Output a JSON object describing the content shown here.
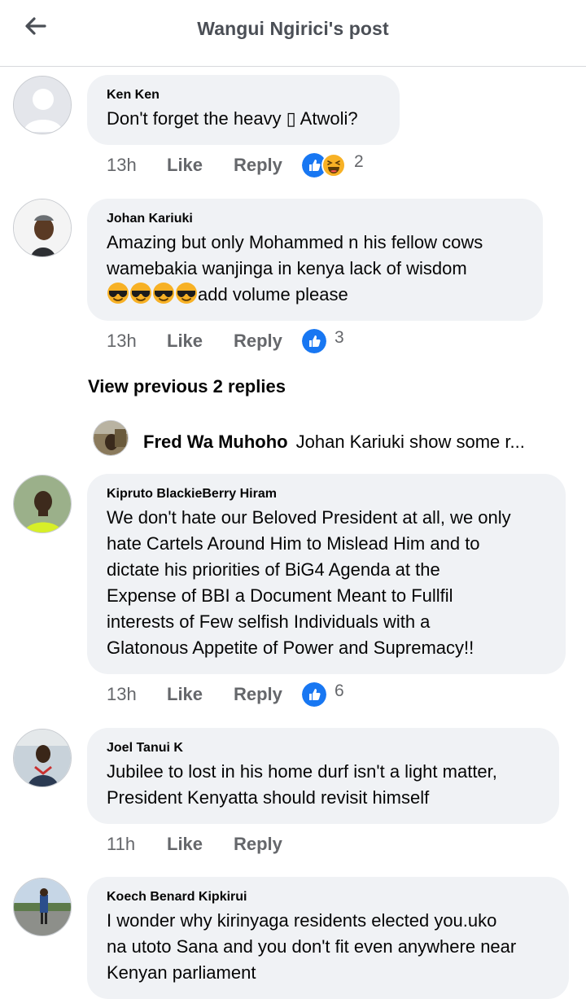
{
  "header": {
    "title": "Wangui Ngirici's post"
  },
  "comments": [
    {
      "author": "Ken Ken",
      "text": "Don't forget the heavy ▯ Atwoli?",
      "time": "13h",
      "like": "Like",
      "reply": "Reply",
      "reaction_icons": [
        "like-reaction-icon",
        "haha-reaction-icon"
      ],
      "reaction_count": "2"
    },
    {
      "author": "Johan Kariuki",
      "text_lines": [
        "Amazing but only Mohammed n his fellow cows",
        "wamebakia wanjinga in kenya lack of wisdom"
      ],
      "text_tail": "add volume please",
      "emojis": [
        "sunglasses-emoji",
        "sunglasses-emoji",
        "sunglasses-emoji",
        "sunglasses-emoji"
      ],
      "time": "13h",
      "like": "Like",
      "reply": "Reply",
      "reaction_icons": [
        "like-reaction-icon"
      ],
      "reaction_count": "3"
    },
    {
      "author": "Kipruto BlackieBerry Hiram",
      "text_lines": [
        "We don't hate our Beloved President at all, we only",
        "hate Cartels Around Him to Mislead Him and to",
        "dictate his priorities of BiG4 Agenda  at the",
        "Expense of BBI a Document Meant to Fullfil",
        "interests of Few selfish  Individuals with a",
        "Glatonous Appetite of Power and Supremacy!!"
      ],
      "time": "13h",
      "like": "Like",
      "reply": "Reply",
      "reaction_icons": [
        "like-reaction-icon"
      ],
      "reaction_count": "6"
    },
    {
      "author": "Joel Tanui K",
      "text_lines": [
        "Jubilee to lost in his home durf isn't a light matter,",
        "President Kenyatta should revisit himself"
      ],
      "time": "11h",
      "like": "Like",
      "reply": "Reply"
    },
    {
      "author": "Koech Benard Kipkirui",
      "text_lines": [
        "I wonder why kirinyaga residents elected you.uko",
        "na utoto Sana and you don't fit even anywhere near",
        "Kenyan parliament"
      ]
    }
  ],
  "view_previous": "View previous 2 replies",
  "reply_preview": {
    "author": "Fred Wa Muhoho",
    "text": "Johan Kariuki show some r..."
  },
  "colors": {
    "like_blue": "#1877f2",
    "haha_yellow": "#f7b125",
    "bubble_gray": "#f0f2f5",
    "meta_gray": "#65676b"
  }
}
